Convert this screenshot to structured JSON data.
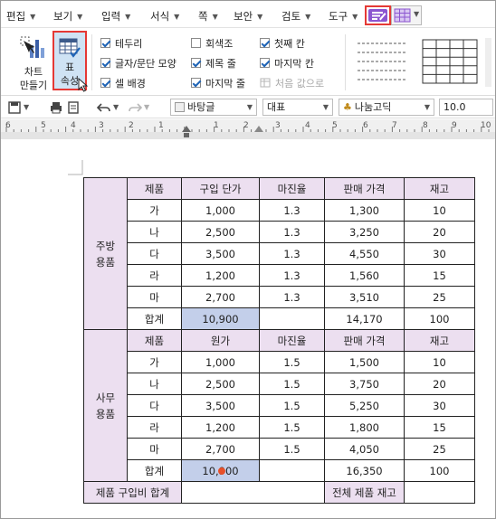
{
  "menu": {
    "items": [
      "편집",
      "보기",
      "입력",
      "서식",
      "쪽",
      "보안",
      "검토",
      "도구"
    ]
  },
  "ribbon": {
    "chart_label_1": "차트",
    "chart_label_2": "만들기",
    "table_label_1": "표",
    "table_label_2": "속성",
    "checkboxes": [
      {
        "label": "테두리",
        "checked": true
      },
      {
        "label": "글자/문단 모양",
        "checked": true
      },
      {
        "label": "셀 배경",
        "checked": true
      },
      {
        "label": "회색조",
        "checked": false
      },
      {
        "label": "제목 줄",
        "checked": true
      },
      {
        "label": "마지막 줄",
        "checked": true
      },
      {
        "label": "첫째 칸",
        "checked": true
      },
      {
        "label": "마지막 칸",
        "checked": true
      },
      {
        "label": "처음 값으로",
        "checked": false
      }
    ]
  },
  "toolbar": {
    "style": "바탕글",
    "font_target": "대표",
    "font": "나눔고딕",
    "size": "10.0"
  },
  "ruler": {
    "labels": [
      "6",
      "5",
      "4",
      "3",
      "2",
      "1",
      "1",
      "2",
      "3",
      "4",
      "5",
      "6",
      "7",
      "8",
      "9",
      "10"
    ]
  },
  "table": {
    "headers_kitchen": [
      "제품",
      "구입 단가",
      "마진율",
      "판매 가격",
      "재고"
    ],
    "headers_office": [
      "제품",
      "원가",
      "마진율",
      "판매 가격",
      "재고"
    ],
    "groups": [
      {
        "name_line1": "주방",
        "name_line2": "용품",
        "rows": [
          [
            "가",
            "1,000",
            "1.3",
            "1,300",
            "10"
          ],
          [
            "나",
            "2,500",
            "1.3",
            "3,250",
            "20"
          ],
          [
            "다",
            "3,500",
            "1.3",
            "4,550",
            "30"
          ],
          [
            "라",
            "1,200",
            "1.3",
            "1,560",
            "15"
          ],
          [
            "마",
            "2,700",
            "1.3",
            "3,510",
            "25"
          ]
        ],
        "total": [
          "합계",
          "10,900",
          "",
          "14,170",
          "100"
        ]
      },
      {
        "name_line1": "사무",
        "name_line2": "용품",
        "rows": [
          [
            "가",
            "1,000",
            "1.5",
            "1,500",
            "10"
          ],
          [
            "나",
            "2,500",
            "1.5",
            "3,750",
            "20"
          ],
          [
            "다",
            "3,500",
            "1.5",
            "5,250",
            "30"
          ],
          [
            "라",
            "1,200",
            "1.5",
            "1,800",
            "15"
          ],
          [
            "마",
            "2,700",
            "1.5",
            "4,050",
            "25"
          ]
        ],
        "total": [
          "합계",
          "10,900",
          "",
          "16,350",
          "100"
        ]
      }
    ],
    "footer": {
      "purchase_total_label": "제품 구입비 합계",
      "purchase_total_value": "",
      "stock_total_label": "전체 제품 재고",
      "stock_total_value": ""
    }
  },
  "colors": {
    "header_bg": "#ecdff0",
    "highlight_bg": "#c3cfea",
    "active_border": "#e53935",
    "checkbox_check": "#1e63b5",
    "cursor_dot": "#e8502a"
  }
}
